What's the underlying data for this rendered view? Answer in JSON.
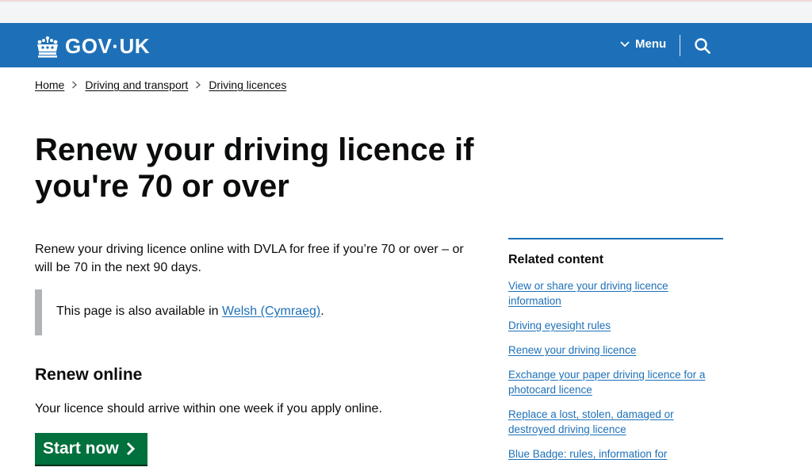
{
  "header": {
    "logo_text": "GOV·UK",
    "menu_label": "Menu"
  },
  "breadcrumb": {
    "items": [
      "Home",
      "Driving and transport",
      "Driving licences"
    ]
  },
  "main": {
    "title": "Renew your driving licence if you're 70 or over",
    "lead": "Renew your driving licence online with DVLA for free if you’re 70 or over – or will be 70 in the next 90 days.",
    "inset_prefix": "This page is also available in ",
    "inset_link": "Welsh (Cymraeg)",
    "inset_suffix": ".",
    "section_heading": "Renew online",
    "section_text": "Your licence should arrive within one week if you apply online.",
    "start_button_label": "Start now"
  },
  "related": {
    "title": "Related content",
    "links": [
      "View or share your driving licence information",
      "Driving eyesight rules",
      "Renew your driving licence",
      "Exchange your paper driving licence for a photocard licence",
      "Replace a lost, stolen, damaged or destroyed driving licence",
      "Blue Badge: rules, information for"
    ]
  },
  "colors": {
    "header_blue": "#1d70b8",
    "link_blue": "#1d70b8",
    "start_green": "#00703c",
    "inset_grey": "#b1b4b6"
  },
  "icons": [
    "crown-icon",
    "chevron-down-icon",
    "search-icon",
    "arrow-right-icon",
    "breadcrumb-chevron-icon"
  ]
}
